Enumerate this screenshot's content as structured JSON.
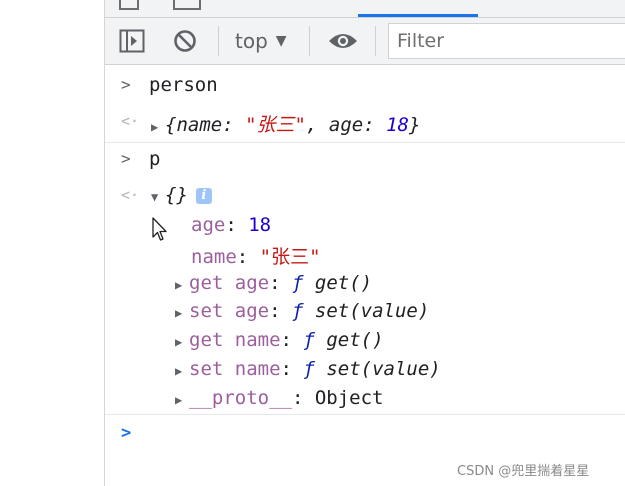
{
  "toolbar": {
    "context_label": "top",
    "context_arrow": "▼",
    "filter_placeholder": "Filter",
    "icons": [
      "sidebar-toggle-icon",
      "clear-console-icon",
      "eye-icon"
    ]
  },
  "console": {
    "entry1": {
      "input": "person",
      "result_open": "{",
      "name_key": "name",
      "name_value": "\"张三\"",
      "age_key": "age",
      "age_value": "18",
      "result_close": "}",
      "comma": ", ",
      "colon": ": "
    },
    "entry2": {
      "input": "p",
      "result": "{}",
      "info_badge": "i",
      "props": [
        {
          "key": "age",
          "value": "18"
        },
        {
          "key": "name",
          "value": "\"张三\""
        }
      ],
      "accessors": [
        {
          "key": "get age",
          "fn": "ƒ",
          "sig": "get()"
        },
        {
          "key": "set age",
          "fn": "ƒ",
          "sig": "set(value)"
        },
        {
          "key": "get name",
          "fn": "ƒ",
          "sig": "get()"
        },
        {
          "key": "set name",
          "fn": "ƒ",
          "sig": "set(value)"
        }
      ],
      "proto": {
        "key": "__proto__",
        "value": "Object"
      }
    },
    "prompt_glyph": ">",
    "result_glyph": "<·"
  },
  "watermark": "CSDN @兜里揣着星星",
  "colors": {
    "accent": "#1a73e8",
    "string": "#c41a16",
    "number": "#1c00cf",
    "property": "#881280"
  }
}
